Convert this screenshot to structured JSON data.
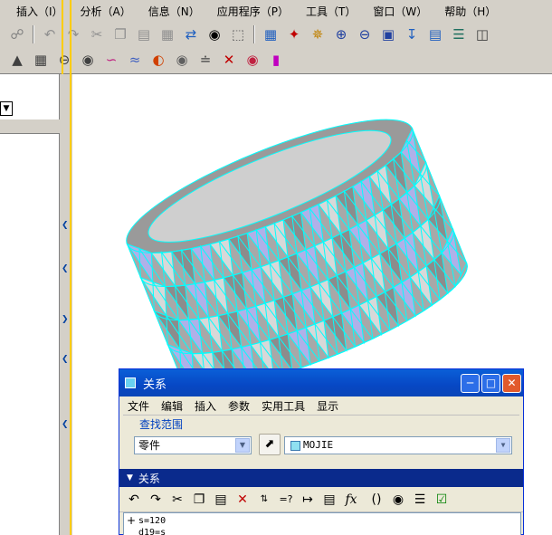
{
  "menubar": {
    "items": [
      "插入（I）",
      "分析（A）",
      "信息（N）",
      "应用程序（P）",
      "工具（T）",
      "窗口（W）",
      "帮助（H）"
    ]
  },
  "toolbar1": {
    "icons": [
      "regenerate-icon",
      "undo-icon",
      "redo-icon",
      "cut-icon",
      "copy-icon",
      "paste-icon",
      "paste-special-icon",
      "regenerate-manager-icon",
      "find-icon",
      "select-box-icon",
      "named-view-icon",
      "datum-display-icon",
      "spin-center-icon",
      "zoom-in-icon",
      "zoom-out-icon",
      "refit-icon",
      "reorient-icon",
      "view-manager-icon",
      "layers-icon",
      "datum-planes-icon"
    ]
  },
  "toolbar2": {
    "icons": [
      "measure-icon",
      "area-icon",
      "diameter-icon",
      "mass-properties-icon",
      "curve-analysis-icon",
      "surface-analysis-icon",
      "curvature-icon",
      "draft-icon",
      "offset-analysis-icon",
      "delete-analysis-icon",
      "shade-icon",
      "color-bars-icon"
    ]
  },
  "colors": {
    "mesh_line": "#00ffff",
    "shade_gray": "#a8a8a8",
    "shade_blue": "#b0b0e8",
    "xp_title": "#0a5fd8"
  },
  "dialog": {
    "title": "关系",
    "menu": [
      "文件",
      "编辑",
      "插入",
      "参数",
      "实用工具",
      "显示"
    ],
    "find_scope_label": "查找范围",
    "type_value": "零件",
    "model_value": "MOJIE",
    "relations_header": "关系",
    "relation_lines": [
      "s=120",
      "d19=s"
    ]
  }
}
